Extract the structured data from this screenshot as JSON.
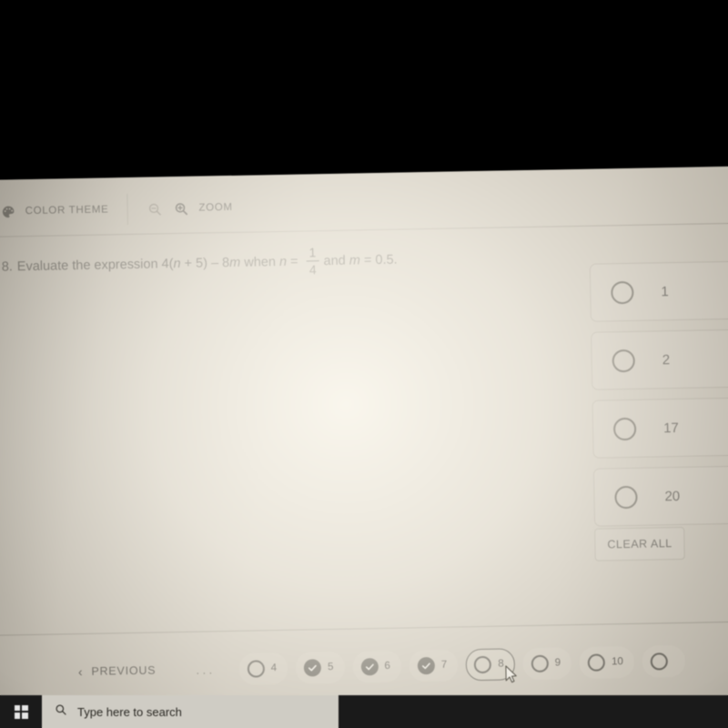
{
  "toolbar": {
    "color_theme_label": "COLOR THEME",
    "color_theme_icon": "palette-icon",
    "zoom_out_icon": "zoom-out-icon",
    "zoom_in_icon": "zoom-in-icon",
    "zoom_label": "ZOOM"
  },
  "question": {
    "number": "8.",
    "text_before": "Evaluate the expression 4(",
    "var_n1": "n",
    "text_mid1": " + 5) – 8",
    "var_m1": "m",
    "text_mid2": " when ",
    "var_n2": "n",
    "equals1": " = ",
    "fraction_numerator": "1",
    "fraction_denominator": "4",
    "text_mid3": "and ",
    "var_m2": "m",
    "equals2": " = 0.5.",
    "full_text": "8. Evaluate the expression 4(n + 5) – 8m when n = 1/4 and m = 0.5."
  },
  "options": [
    {
      "label": "1",
      "selected": false
    },
    {
      "label": "2",
      "selected": false
    },
    {
      "label": "17",
      "selected": false
    },
    {
      "label": "20",
      "selected": false
    }
  ],
  "clear_all_label": "CLEAR ALL",
  "footer": {
    "previous_label": "PREVIOUS",
    "previous_chevron": "chevron-left-icon",
    "ellipsis": "...",
    "pages": [
      {
        "number": "4",
        "state": "unanswered",
        "current": false
      },
      {
        "number": "5",
        "state": "answered",
        "current": false
      },
      {
        "number": "6",
        "state": "answered",
        "current": false
      },
      {
        "number": "7",
        "state": "answered",
        "current": false
      },
      {
        "number": "8",
        "state": "unanswered",
        "current": true
      },
      {
        "number": "9",
        "state": "unanswered",
        "current": false
      },
      {
        "number": "10",
        "state": "unanswered",
        "current": false
      },
      {
        "number": "",
        "state": "unanswered",
        "current": false
      }
    ]
  },
  "taskbar": {
    "start_icon": "windows-start-icon",
    "search_icon": "search-icon",
    "search_placeholder": "Type here to search"
  },
  "colors": {
    "screen_base": "#b9b3a7",
    "text": "#1d1b17",
    "pill_background": "#c4beb2",
    "pill_done": "#35332c",
    "taskbar": "#1a1a1a",
    "search_box": "#cfccc4"
  }
}
